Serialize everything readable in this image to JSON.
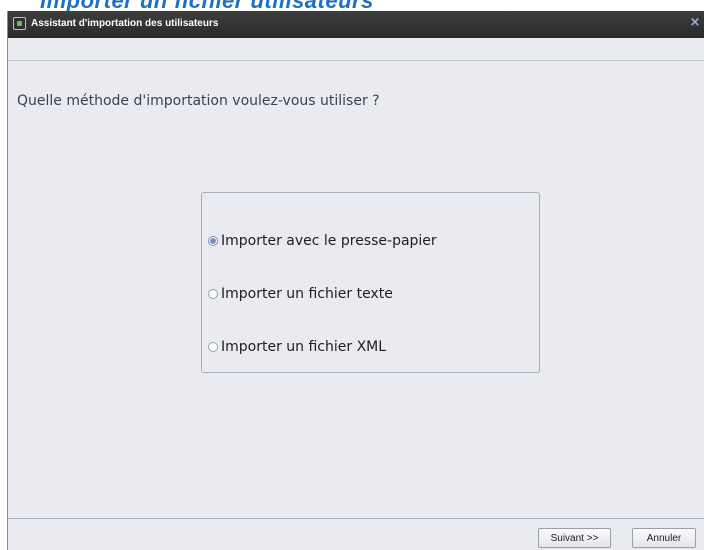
{
  "heading": "Importer un fichier utilisateurs",
  "window": {
    "title": "Assistant d'importation des utilisateurs",
    "close_glyph": "×"
  },
  "question": "Quelle méthode d'importation voulez-vous utiliser ?",
  "options": [
    {
      "label": "Importer avec le presse-papier",
      "selected": true
    },
    {
      "label": "Importer un fichier texte",
      "selected": false
    },
    {
      "label": "Importer un fichier XML",
      "selected": false
    }
  ],
  "buttons": {
    "next": "Suivant >>",
    "cancel": "Annuler"
  },
  "colors": {
    "title_bar": "#2f2f2f",
    "background": "#e9ebf1",
    "heading": "#1f6fc4"
  }
}
